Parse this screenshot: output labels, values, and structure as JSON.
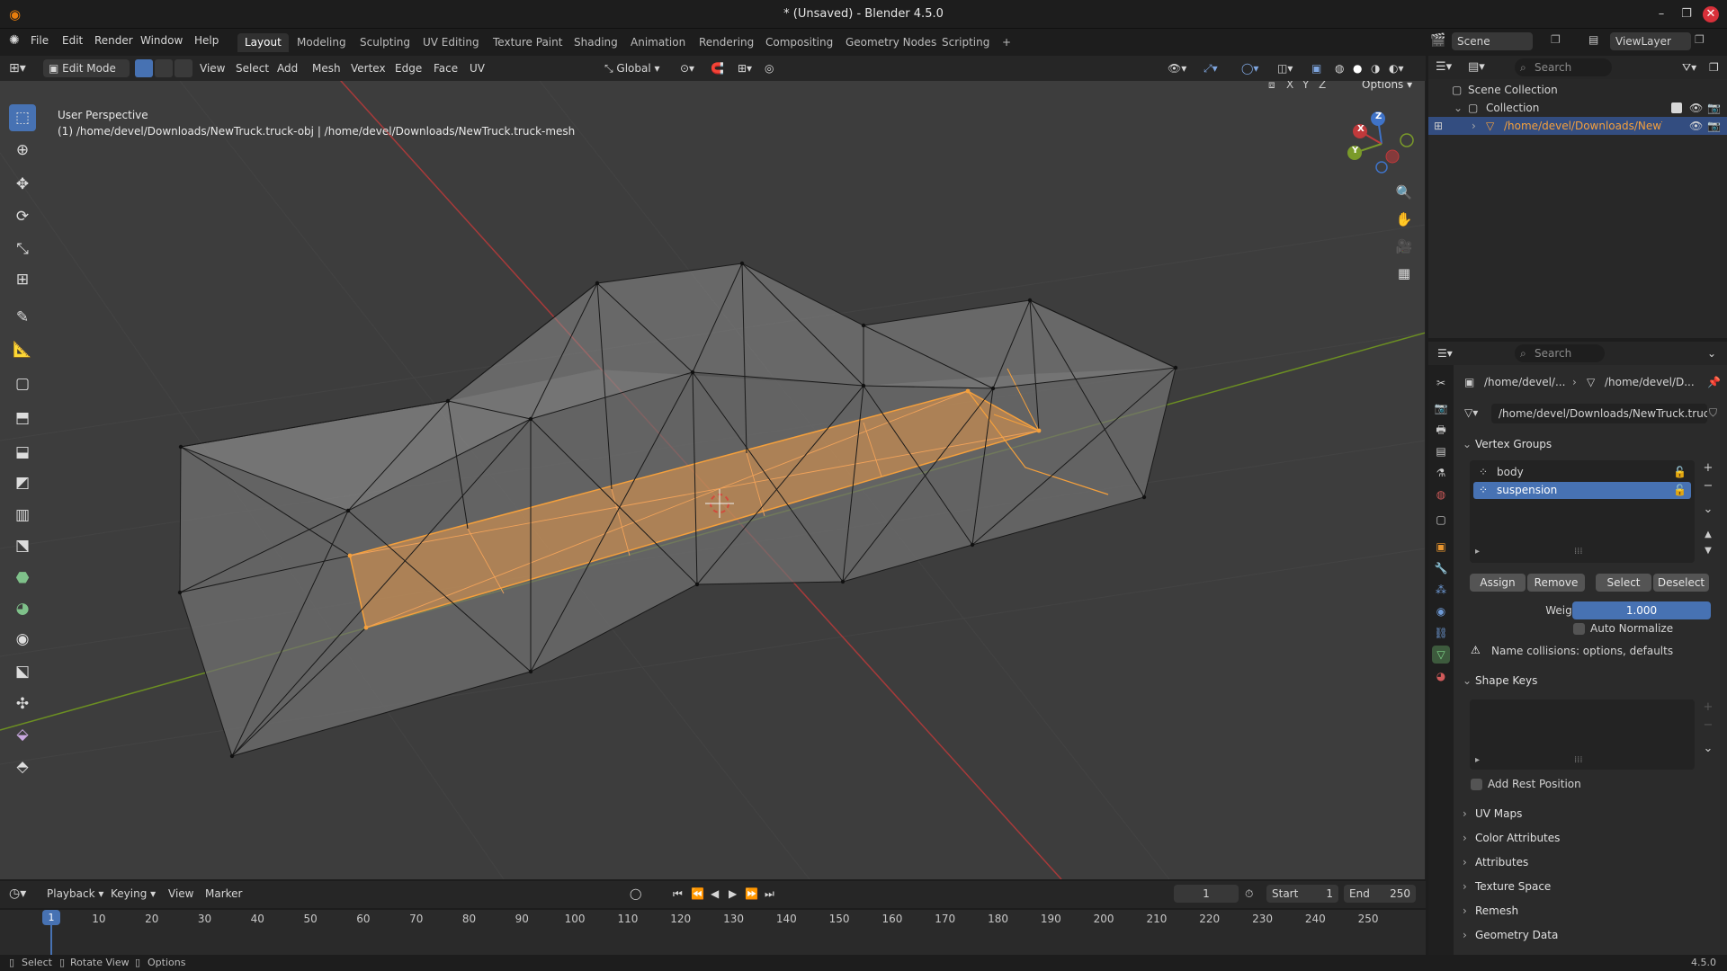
{
  "window": {
    "title": "* (Unsaved) - Blender 4.5.0",
    "minimize": "–",
    "maximize": "❐",
    "close": "✕"
  },
  "menus": [
    "File",
    "Edit",
    "Render",
    "Window",
    "Help"
  ],
  "workspaces": [
    "Layout",
    "Modeling",
    "Sculpting",
    "UV Editing",
    "Texture Paint",
    "Shading",
    "Animation",
    "Rendering",
    "Compositing",
    "Geometry Nodes",
    "Scripting",
    "+"
  ],
  "active_workspace": "Layout",
  "topright": {
    "scene": "Scene",
    "viewlayer": "ViewLayer"
  },
  "viewport_header": {
    "mode": "Edit Mode",
    "menus": [
      "View",
      "Select",
      "Add",
      "Mesh",
      "Vertex",
      "Edge",
      "Face",
      "UV"
    ],
    "orientation": "Global",
    "axes": [
      "X",
      "Y",
      "Z"
    ],
    "options": "Options"
  },
  "viewport": {
    "perspective": "User Perspective",
    "object_info": "(1) /home/devel/Downloads/NewTruck.truck-obj | /home/devel/Downloads/NewTruck.truck-mesh",
    "gizmo": {
      "x": "X",
      "y": "Y",
      "z": "Z"
    }
  },
  "timeline": {
    "menus": [
      "Playback",
      "Keying",
      "View",
      "Marker"
    ],
    "current_frame": "1",
    "start_label": "Start",
    "start": "1",
    "end_label": "End",
    "end": "250",
    "ticks": [
      "1",
      "10",
      "20",
      "30",
      "40",
      "50",
      "60",
      "70",
      "80",
      "90",
      "100",
      "110",
      "120",
      "130",
      "140",
      "150",
      "160",
      "170",
      "180",
      "190",
      "200",
      "210",
      "220",
      "230",
      "240",
      "250"
    ],
    "playhead": "1"
  },
  "statusbar": {
    "items": [
      "Select",
      "Rotate View",
      "Options"
    ],
    "version": "4.5.0"
  },
  "outliner": {
    "search_placeholder": "Search",
    "scene_collection": "Scene Collection",
    "collection": "Collection",
    "object": "/home/devel/Downloads/NewTru"
  },
  "properties": {
    "search_placeholder": "Search",
    "breadcrumb_1": "/home/devel/...",
    "breadcrumb_2": "/home/devel/D...",
    "datablock": "/home/devel/Downloads/NewTruck.truc...",
    "vertex_groups": {
      "title": "Vertex Groups",
      "items": [
        {
          "name": "body",
          "selected": false
        },
        {
          "name": "suspension",
          "selected": true
        }
      ],
      "assign": "Assign",
      "remove": "Remove",
      "select": "Select",
      "deselect": "Deselect",
      "weight_label": "Weight",
      "weight": "1.000",
      "auto_normalize": "Auto Normalize",
      "warning": "Name collisions: options, defaults"
    },
    "shape_keys": {
      "title": "Shape Keys",
      "add_rest": "Add Rest Position"
    },
    "collapsed": [
      "UV Maps",
      "Color Attributes",
      "Attributes",
      "Texture Space",
      "Remesh",
      "Geometry Data"
    ]
  },
  "colors": {
    "accent": "#4772b3",
    "selection": "#f5a03c",
    "x_axis": "#c0393b",
    "y_axis": "#7a9a2a"
  }
}
